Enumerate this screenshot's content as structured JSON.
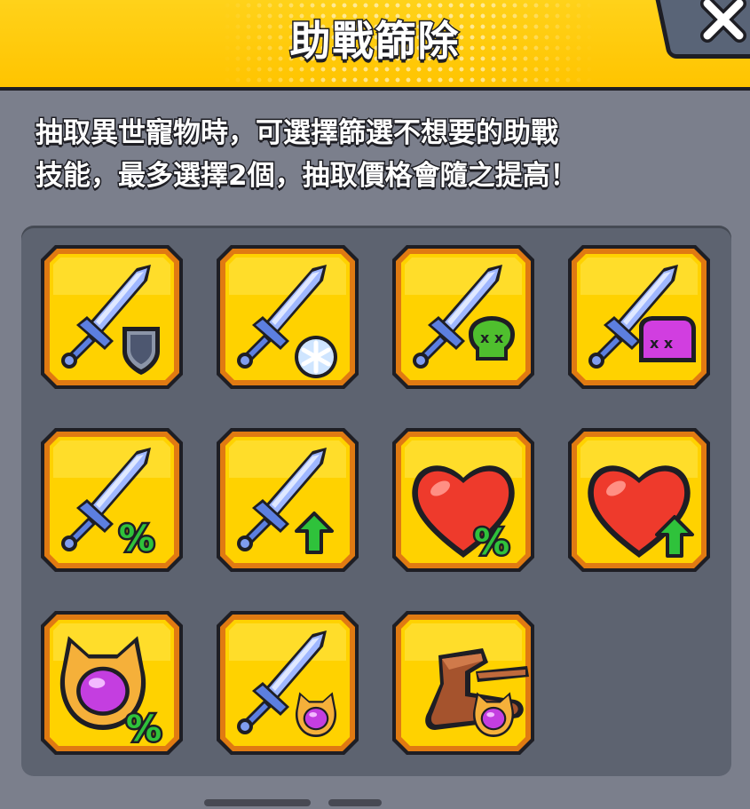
{
  "header": {
    "title": "助戰篩除",
    "close_icon": "close-icon"
  },
  "description": {
    "line1": "抽取異世寵物時，可選擇篩選不想要的助戰",
    "line2": "技能，最多選擇2個，抽取價格會隨之提高！"
  },
  "skills": [
    {
      "icon": "sword-shield-icon"
    },
    {
      "icon": "sword-snowflake-icon"
    },
    {
      "icon": "sword-poison-skull-icon"
    },
    {
      "icon": "sword-curse-ghost-icon"
    },
    {
      "icon": "sword-percent-icon"
    },
    {
      "icon": "sword-up-arrow-icon"
    },
    {
      "icon": "heart-percent-icon"
    },
    {
      "icon": "heart-up-arrow-icon"
    },
    {
      "icon": "pet-percent-icon"
    },
    {
      "icon": "sword-pet-icon"
    },
    {
      "icon": "boot-pet-icon"
    }
  ],
  "colors": {
    "header": "#ffc400",
    "tile": "#ffd200",
    "tile_border": "#e07a12",
    "panel": "#5d6370",
    "background": "#7b7f8c"
  }
}
